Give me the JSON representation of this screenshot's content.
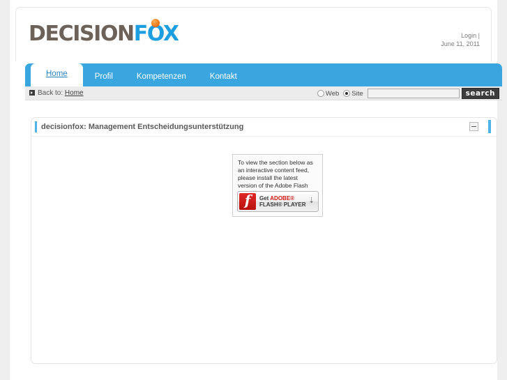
{
  "brand": {
    "logo_primary": "DECISION",
    "logo_secondary": "FOX",
    "logo_dot_color": "#f47b20",
    "accent_color": "#3aa6e0"
  },
  "header": {
    "login_label": "Login |",
    "date": "June 11, 2011"
  },
  "nav": {
    "items": [
      {
        "label": "Home",
        "active": true
      },
      {
        "label": "Profil",
        "active": false
      },
      {
        "label": "Kompetenzen",
        "active": false
      },
      {
        "label": "Kontakt",
        "active": false
      }
    ]
  },
  "utility": {
    "back_to_prefix": "Back to:",
    "back_to_link": "Home",
    "search": {
      "scope_web": "Web",
      "scope_site": "Site",
      "selected_scope": "Site",
      "input_value": "",
      "input_placeholder": "",
      "button_label": "search"
    }
  },
  "panel": {
    "title": "decisionfox: Management Entscheidungsunterstützung",
    "collapse_icon": "minus-icon",
    "accent_color": "#4eb3e8"
  },
  "flash_prompt": {
    "message": "To view the section below as an interactive content feed, please install the latest version of the Adobe Flash Player.",
    "button": {
      "line1_get": "Get ",
      "line1_brand": "ADOBE®",
      "line2": "FLASH® PLAYER",
      "download_icon": "download-arrow-icon"
    }
  }
}
